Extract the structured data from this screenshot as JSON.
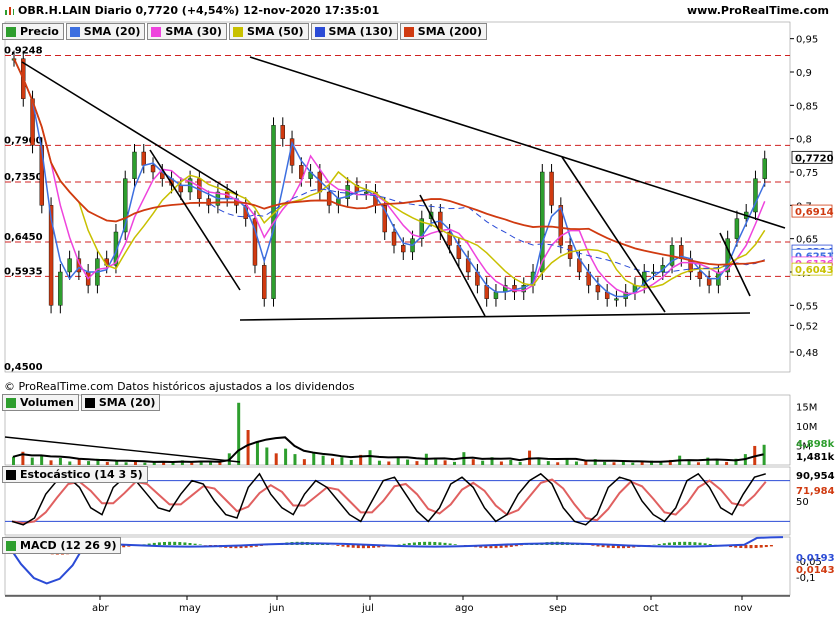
{
  "header": {
    "symbol_line": "OBR.H.LAIN Diario 0,7720 (+4,54%) 12-nov-2020 17:35:01",
    "site": "www.ProRealTime.com"
  },
  "price_legend": [
    {
      "label": "Precio",
      "color": "#2e9e2e"
    },
    {
      "label": "SMA (20)",
      "color": "#3d6fe0"
    },
    {
      "label": "SMA (30)",
      "color": "#ee44dd"
    },
    {
      "label": "SMA (50)",
      "color": "#c8c000"
    },
    {
      "label": "SMA (130)",
      "color": "#2b4bd6"
    },
    {
      "label": "SMA (200)",
      "color": "#d03a10"
    }
  ],
  "footer_note": "© ProRealTime.com  Datos históricos ajustados a los dividendos",
  "volume_legend": [
    {
      "label": "Volumen",
      "color": "#2e9e2e"
    },
    {
      "label": "SMA (20)",
      "color": "#000000"
    }
  ],
  "stoch_title": "Estocástico (14 3 5)",
  "macd_title": "MACD (12 26 9)",
  "chart_data": [
    {
      "type": "candlestick",
      "title": "OBR.H.LAIN Diario",
      "last": "0,7720",
      "change": "+4,54%",
      "y_ticks": [
        "0,95",
        "0,9",
        "0,85",
        "0,8",
        "0,75",
        "0,7",
        "0,65",
        "0,6",
        "0,55",
        "0,52",
        "0,48"
      ],
      "ylim": [
        0.45,
        0.975
      ],
      "horizontal_levels": [
        0.9248,
        0.79,
        0.735,
        0.645,
        0.5935
      ],
      "level_labels": [
        "0,9248",
        "0,7900",
        "0,7350",
        "0,6450",
        "0,5935",
        "0,4500"
      ],
      "right_tags": [
        {
          "text": "0,7720",
          "color": "#000000",
          "value": 0.772
        },
        {
          "text": "0,6914",
          "color": "#d03a10",
          "value": 0.6914
        },
        {
          "text": "0,6314",
          "color": "#2b4bd6",
          "value": 0.6314
        },
        {
          "text": "0,6251",
          "color": "#3d6fe0",
          "value": 0.6251
        },
        {
          "text": "0,6136",
          "color": "#ee44dd",
          "value": 0.6136
        },
        {
          "text": "0,6043",
          "color": "#c8c000",
          "value": 0.6043
        }
      ],
      "x_ticks": [
        "abr",
        "may",
        "jun",
        "jul",
        "ago",
        "sep",
        "oct",
        "nov"
      ],
      "closes": [
        0.92,
        0.86,
        0.79,
        0.7,
        0.55,
        0.6,
        0.62,
        0.6,
        0.58,
        0.62,
        0.61,
        0.66,
        0.74,
        0.78,
        0.76,
        0.75,
        0.74,
        0.73,
        0.72,
        0.74,
        0.71,
        0.7,
        0.72,
        0.71,
        0.7,
        0.68,
        0.61,
        0.56,
        0.82,
        0.8,
        0.76,
        0.74,
        0.75,
        0.72,
        0.7,
        0.71,
        0.73,
        0.72,
        0.72,
        0.7,
        0.66,
        0.64,
        0.63,
        0.65,
        0.68,
        0.69,
        0.66,
        0.64,
        0.62,
        0.6,
        0.58,
        0.56,
        0.57,
        0.58,
        0.57,
        0.58,
        0.6,
        0.75,
        0.7,
        0.64,
        0.62,
        0.6,
        0.58,
        0.57,
        0.56,
        0.56,
        0.57,
        0.58,
        0.6,
        0.6,
        0.61,
        0.64,
        0.62,
        0.6,
        0.59,
        0.58,
        0.6,
        0.65,
        0.68,
        0.69,
        0.74,
        0.77
      ]
    },
    {
      "type": "bar",
      "title": "Volumen",
      "y_ticks": [
        "15M",
        "10M",
        "5M"
      ],
      "right_tags": [
        {
          "text": "4,898k",
          "color": "#2e9e2e"
        },
        {
          "text": "1,481k",
          "color": "#000000"
        }
      ],
      "values_m": [
        2.1,
        3.4,
        1.9,
        2.5,
        1.2,
        1.8,
        0.9,
        1.4,
        1.0,
        1.6,
        0.8,
        1.1,
        0.7,
        0.9,
        0.6,
        0.8,
        1.0,
        0.7,
        1.2,
        0.6,
        1.1,
        0.8,
        0.7,
        3.0,
        16.0,
        9.0,
        6.0,
        4.5,
        3.0,
        4.2,
        2.8,
        1.5,
        3.2,
        2.4,
        1.7,
        2.0,
        1.3,
        2.6,
        3.8,
        1.1,
        0.9,
        2.2,
        1.4,
        1.0,
        2.9,
        1.6,
        1.2,
        0.8,
        3.3,
        1.5,
        1.1,
        2.0,
        0.9,
        1.3,
        0.8,
        3.7,
        1.8,
        1.0,
        0.7,
        1.4,
        0.9,
        1.2,
        1.5,
        0.8,
        0.7,
        1.0,
        0.6,
        0.9,
        1.1,
        0.8,
        1.3,
        2.4,
        1.0,
        0.7,
        1.9,
        1.2,
        0.8,
        1.6,
        2.8,
        4.9,
        5.2
      ]
    },
    {
      "type": "line",
      "title": "Estocástico (14 3 5)",
      "y_ticks": [
        "50"
      ],
      "right_tags": [
        {
          "text": "90,954",
          "color": "#000000"
        },
        {
          "text": "71,984",
          "color": "#d03a10"
        }
      ],
      "ylim": [
        0,
        100
      ]
    },
    {
      "type": "line",
      "title": "MACD (12 26 9)",
      "y_ticks": [
        "-0,05",
        "-0,1"
      ],
      "right_tags": [
        {
          "text": "0,0193",
          "color": "#2b4bd6"
        },
        {
          "text": "0,0143",
          "color": "#d03a10"
        }
      ]
    }
  ]
}
